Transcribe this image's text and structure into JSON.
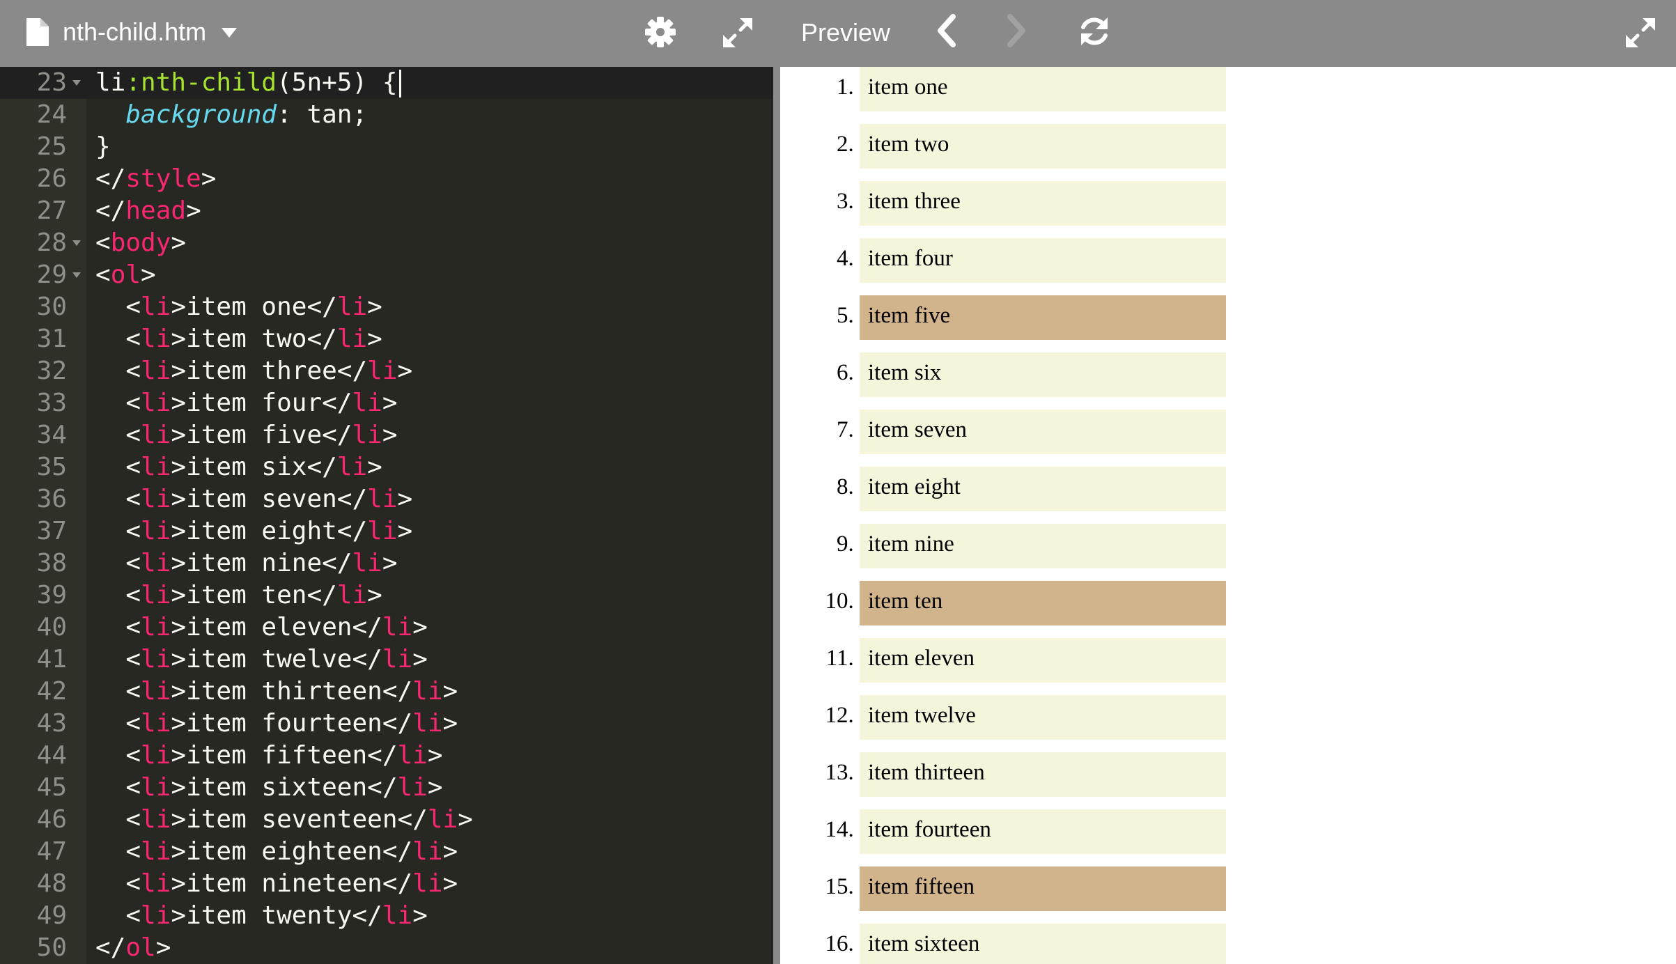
{
  "editor": {
    "file_name": "nth-child.htm",
    "icons": {
      "file": "file-icon",
      "dropdown": "chevron-down-icon",
      "settings": "gear-icon",
      "expand": "expand-icon"
    }
  },
  "code_lines": [
    {
      "num": "23",
      "fold": true,
      "tokens": [
        [
          "sel",
          "li"
        ],
        [
          "pseudo",
          ":nth-child"
        ],
        [
          "pc",
          "(5n+5) {"
        ]
      ],
      "cursor": true
    },
    {
      "num": "24",
      "fold": false,
      "tokens": [
        [
          "pc",
          "  "
        ],
        [
          "prop",
          "background"
        ],
        [
          "pc",
          ": tan;"
        ]
      ]
    },
    {
      "num": "25",
      "fold": false,
      "tokens": [
        [
          "pc",
          "}"
        ]
      ]
    },
    {
      "num": "26",
      "fold": false,
      "tokens": [
        [
          "pc",
          "</"
        ],
        [
          "tag",
          "style"
        ],
        [
          "pc",
          ">"
        ]
      ]
    },
    {
      "num": "27",
      "fold": false,
      "tokens": [
        [
          "pc",
          "</"
        ],
        [
          "tag",
          "head"
        ],
        [
          "pc",
          ">"
        ]
      ]
    },
    {
      "num": "28",
      "fold": true,
      "tokens": [
        [
          "pc",
          "<"
        ],
        [
          "tag",
          "body"
        ],
        [
          "pc",
          ">"
        ]
      ]
    },
    {
      "num": "29",
      "fold": true,
      "tokens": [
        [
          "pc",
          "<"
        ],
        [
          "tag",
          "ol"
        ],
        [
          "pc",
          ">"
        ]
      ]
    },
    {
      "num": "30",
      "fold": false,
      "tokens": [
        [
          "pc",
          "  <"
        ],
        [
          "tag",
          "li"
        ],
        [
          "pc",
          ">item one</"
        ],
        [
          "tag",
          "li"
        ],
        [
          "pc",
          ">"
        ]
      ]
    },
    {
      "num": "31",
      "fold": false,
      "tokens": [
        [
          "pc",
          "  <"
        ],
        [
          "tag",
          "li"
        ],
        [
          "pc",
          ">item two</"
        ],
        [
          "tag",
          "li"
        ],
        [
          "pc",
          ">"
        ]
      ]
    },
    {
      "num": "32",
      "fold": false,
      "tokens": [
        [
          "pc",
          "  <"
        ],
        [
          "tag",
          "li"
        ],
        [
          "pc",
          ">item three</"
        ],
        [
          "tag",
          "li"
        ],
        [
          "pc",
          ">"
        ]
      ]
    },
    {
      "num": "33",
      "fold": false,
      "tokens": [
        [
          "pc",
          "  <"
        ],
        [
          "tag",
          "li"
        ],
        [
          "pc",
          ">item four</"
        ],
        [
          "tag",
          "li"
        ],
        [
          "pc",
          ">"
        ]
      ]
    },
    {
      "num": "34",
      "fold": false,
      "tokens": [
        [
          "pc",
          "  <"
        ],
        [
          "tag",
          "li"
        ],
        [
          "pc",
          ">item five</"
        ],
        [
          "tag",
          "li"
        ],
        [
          "pc",
          ">"
        ]
      ]
    },
    {
      "num": "35",
      "fold": false,
      "tokens": [
        [
          "pc",
          "  <"
        ],
        [
          "tag",
          "li"
        ],
        [
          "pc",
          ">item six</"
        ],
        [
          "tag",
          "li"
        ],
        [
          "pc",
          ">"
        ]
      ]
    },
    {
      "num": "36",
      "fold": false,
      "tokens": [
        [
          "pc",
          "  <"
        ],
        [
          "tag",
          "li"
        ],
        [
          "pc",
          ">item seven</"
        ],
        [
          "tag",
          "li"
        ],
        [
          "pc",
          ">"
        ]
      ]
    },
    {
      "num": "37",
      "fold": false,
      "tokens": [
        [
          "pc",
          "  <"
        ],
        [
          "tag",
          "li"
        ],
        [
          "pc",
          ">item eight</"
        ],
        [
          "tag",
          "li"
        ],
        [
          "pc",
          ">"
        ]
      ]
    },
    {
      "num": "38",
      "fold": false,
      "tokens": [
        [
          "pc",
          "  <"
        ],
        [
          "tag",
          "li"
        ],
        [
          "pc",
          ">item nine</"
        ],
        [
          "tag",
          "li"
        ],
        [
          "pc",
          ">"
        ]
      ]
    },
    {
      "num": "39",
      "fold": false,
      "tokens": [
        [
          "pc",
          "  <"
        ],
        [
          "tag",
          "li"
        ],
        [
          "pc",
          ">item ten</"
        ],
        [
          "tag",
          "li"
        ],
        [
          "pc",
          ">"
        ]
      ]
    },
    {
      "num": "40",
      "fold": false,
      "tokens": [
        [
          "pc",
          "  <"
        ],
        [
          "tag",
          "li"
        ],
        [
          "pc",
          ">item eleven</"
        ],
        [
          "tag",
          "li"
        ],
        [
          "pc",
          ">"
        ]
      ]
    },
    {
      "num": "41",
      "fold": false,
      "tokens": [
        [
          "pc",
          "  <"
        ],
        [
          "tag",
          "li"
        ],
        [
          "pc",
          ">item twelve</"
        ],
        [
          "tag",
          "li"
        ],
        [
          "pc",
          ">"
        ]
      ]
    },
    {
      "num": "42",
      "fold": false,
      "tokens": [
        [
          "pc",
          "  <"
        ],
        [
          "tag",
          "li"
        ],
        [
          "pc",
          ">item thirteen</"
        ],
        [
          "tag",
          "li"
        ],
        [
          "pc",
          ">"
        ]
      ]
    },
    {
      "num": "43",
      "fold": false,
      "tokens": [
        [
          "pc",
          "  <"
        ],
        [
          "tag",
          "li"
        ],
        [
          "pc",
          ">item fourteen</"
        ],
        [
          "tag",
          "li"
        ],
        [
          "pc",
          ">"
        ]
      ]
    },
    {
      "num": "44",
      "fold": false,
      "tokens": [
        [
          "pc",
          "  <"
        ],
        [
          "tag",
          "li"
        ],
        [
          "pc",
          ">item fifteen</"
        ],
        [
          "tag",
          "li"
        ],
        [
          "pc",
          ">"
        ]
      ]
    },
    {
      "num": "45",
      "fold": false,
      "tokens": [
        [
          "pc",
          "  <"
        ],
        [
          "tag",
          "li"
        ],
        [
          "pc",
          ">item sixteen</"
        ],
        [
          "tag",
          "li"
        ],
        [
          "pc",
          ">"
        ]
      ]
    },
    {
      "num": "46",
      "fold": false,
      "tokens": [
        [
          "pc",
          "  <"
        ],
        [
          "tag",
          "li"
        ],
        [
          "pc",
          ">item seventeen</"
        ],
        [
          "tag",
          "li"
        ],
        [
          "pc",
          ">"
        ]
      ]
    },
    {
      "num": "47",
      "fold": false,
      "tokens": [
        [
          "pc",
          "  <"
        ],
        [
          "tag",
          "li"
        ],
        [
          "pc",
          ">item eighteen</"
        ],
        [
          "tag",
          "li"
        ],
        [
          "pc",
          ">"
        ]
      ]
    },
    {
      "num": "48",
      "fold": false,
      "tokens": [
        [
          "pc",
          "  <"
        ],
        [
          "tag",
          "li"
        ],
        [
          "pc",
          ">item nineteen</"
        ],
        [
          "tag",
          "li"
        ],
        [
          "pc",
          ">"
        ]
      ]
    },
    {
      "num": "49",
      "fold": false,
      "tokens": [
        [
          "pc",
          "  <"
        ],
        [
          "tag",
          "li"
        ],
        [
          "pc",
          ">item twenty</"
        ],
        [
          "tag",
          "li"
        ],
        [
          "pc",
          ">"
        ]
      ]
    },
    {
      "num": "50",
      "fold": false,
      "tokens": [
        [
          "pc",
          "</"
        ],
        [
          "tag",
          "ol"
        ],
        [
          "pc",
          ">"
        ]
      ]
    }
  ],
  "preview": {
    "title": "Preview",
    "icons": {
      "back": "chevron-left-icon",
      "forward": "chevron-right-icon",
      "refresh": "refresh-icon",
      "expand": "expand-icon"
    },
    "items": [
      {
        "label": "item one",
        "highlighted": false
      },
      {
        "label": "item two",
        "highlighted": false
      },
      {
        "label": "item three",
        "highlighted": false
      },
      {
        "label": "item four",
        "highlighted": false
      },
      {
        "label": "item five",
        "highlighted": true
      },
      {
        "label": "item six",
        "highlighted": false
      },
      {
        "label": "item seven",
        "highlighted": false
      },
      {
        "label": "item eight",
        "highlighted": false
      },
      {
        "label": "item nine",
        "highlighted": false
      },
      {
        "label": "item ten",
        "highlighted": true
      },
      {
        "label": "item eleven",
        "highlighted": false
      },
      {
        "label": "item twelve",
        "highlighted": false
      },
      {
        "label": "item thirteen",
        "highlighted": false
      },
      {
        "label": "item fourteen",
        "highlighted": false
      },
      {
        "label": "item fifteen",
        "highlighted": true
      },
      {
        "label": "item sixteen",
        "highlighted": false
      }
    ]
  },
  "colors": {
    "toolbar": "#8a8a8a",
    "editor_bg": "#272822",
    "gutter_bg": "#2f3129",
    "tag": "#f92672",
    "pseudo": "#a6e22e",
    "property": "#66d9ef",
    "item_bg": "#f5f5dc",
    "item_highlight": "#d2b48c"
  }
}
